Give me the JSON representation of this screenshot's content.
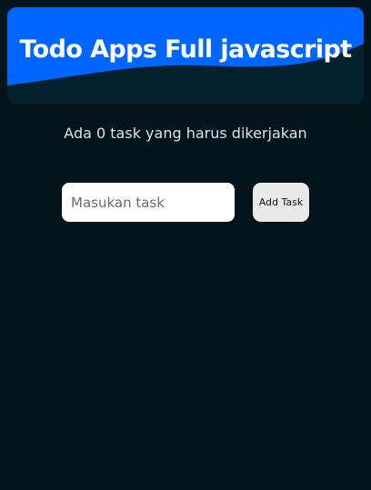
{
  "header": {
    "title": "Todo Apps Full javascript"
  },
  "summary": {
    "task_count_text": "Ada 0 task yang harus dikerjakan"
  },
  "form": {
    "input_placeholder": "Masukan task",
    "input_value": "",
    "add_button_label": "Add Task"
  },
  "colors": {
    "background": "#04141b",
    "header_dark": "#04222d",
    "header_accent": "#0066ff"
  }
}
